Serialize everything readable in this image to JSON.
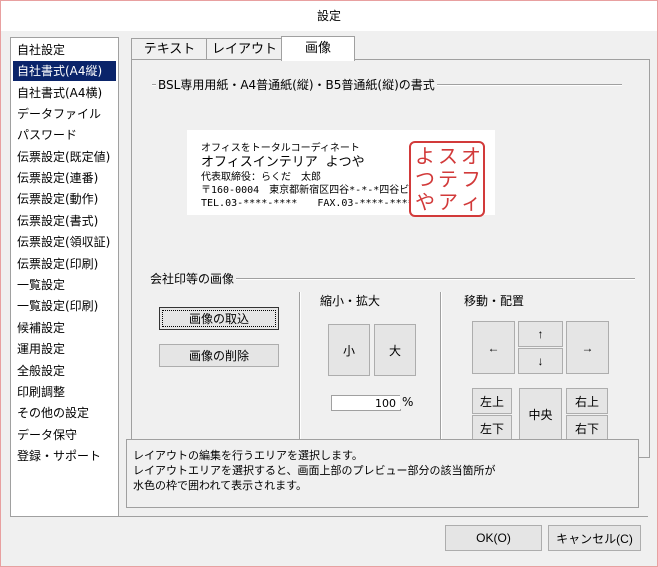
{
  "window": {
    "title": "設定"
  },
  "sidebar": {
    "items": [
      "自社設定",
      "自社書式(A4縦)",
      "自社書式(A4横)",
      "データファイル",
      "パスワード",
      "伝票設定(既定値)",
      "伝票設定(連番)",
      "伝票設定(動作)",
      "伝票設定(書式)",
      "伝票設定(領収証)",
      "伝票設定(印刷)",
      "一覧設定",
      "一覧設定(印刷)",
      "候補設定",
      "運用設定",
      "全般設定",
      "印刷調整",
      "その他の設定",
      "データ保守",
      "登録・サポート"
    ],
    "selected": "自社書式(A4縦)"
  },
  "tabs": [
    {
      "label": "テキスト"
    },
    {
      "label": "レイアウト"
    },
    {
      "label": "画像",
      "active": true
    }
  ],
  "form": {
    "heading": "BSL専用用紙・A4普通紙(縦)・B5普通紙(縦)の書式",
    "preview": {
      "line1": "オフィスをトータルコーディネート",
      "line2": "オフィスインテリア よつや",
      "line3": "代表取締役：らくだ　太郎",
      "line4": "〒160-0004　東京都新宿区四谷*-*-*四谷ビル3階",
      "line5": "TEL.03-****-****　　FAX.03-****-****",
      "stamp_text": "よつやオフィスインテリア"
    },
    "image_group": {
      "title": "会社印等の画像",
      "import_button": "画像の取込",
      "delete_button": "画像の削除"
    },
    "scale_group": {
      "title": "縮小・拡大",
      "shrink_button": "小",
      "enlarge_button": "大",
      "value": "100",
      "unit": "%"
    },
    "move_group": {
      "title": "移動・配置",
      "left_button": "←",
      "up_button": "↑",
      "down_button": "↓",
      "right_button": "→",
      "top_left_button": "左上",
      "bottom_left_button": "左下",
      "center_button": "中央",
      "top_right_button": "右上",
      "bottom_right_button": "右下"
    }
  },
  "message": {
    "line1": "レイアウトの編集を行うエリアを選択します。",
    "line2": "レイアウトエリアを選択すると、画面上部のプレビュー部分の該当箇所が",
    "line3": "水色の枠で囲われて表示されます。"
  },
  "footer": {
    "ok_button": "OK(O)",
    "cancel_button": "キャンセル(C)"
  }
}
